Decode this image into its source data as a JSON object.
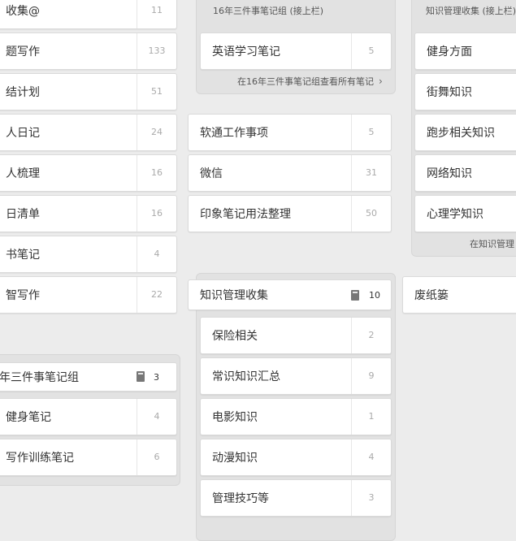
{
  "col1": {
    "notebooks": [
      {
        "label": "收集@",
        "count": "11"
      },
      {
        "label": "题写作",
        "count": "133"
      },
      {
        "label": "结计划",
        "count": "51"
      },
      {
        "label": "人日记",
        "count": "24"
      },
      {
        "label": "人梳理",
        "count": "16"
      },
      {
        "label": "日清单",
        "count": "16"
      },
      {
        "label": "书笔记",
        "count": "4"
      },
      {
        "label": "智写作",
        "count": "22"
      }
    ],
    "stack": {
      "title": "年三件事笔记组",
      "count": "3",
      "notebooks": [
        {
          "label": "健身笔记",
          "count": "4"
        },
        {
          "label": "写作训练笔记",
          "count": "6"
        }
      ]
    }
  },
  "col2": {
    "stack_top": {
      "title": "16年三件事笔记组 (接上栏)",
      "notebooks": [
        {
          "label": "英语学习笔记",
          "count": "5"
        }
      ],
      "footer": "在16年三件事笔记组查看所有笔记"
    },
    "notebooks": [
      {
        "label": "软通工作事项",
        "count": "5"
      },
      {
        "label": "微信",
        "count": "31"
      },
      {
        "label": "印象笔记用法整理",
        "count": "50"
      }
    ],
    "stack": {
      "title": "知识管理收集",
      "count": "10",
      "notebooks": [
        {
          "label": "保险相关",
          "count": "2"
        },
        {
          "label": "常识知识汇总",
          "count": "9"
        },
        {
          "label": "电影知识",
          "count": "1"
        },
        {
          "label": "动漫知识",
          "count": "4"
        },
        {
          "label": "管理技巧等",
          "count": "3"
        }
      ]
    }
  },
  "col3": {
    "stack_top": {
      "title": "知识管理收集 (接上栏)",
      "notebooks": [
        {
          "label": "健身方面"
        },
        {
          "label": "街舞知识"
        },
        {
          "label": "跑步相关知识"
        },
        {
          "label": "网络知识"
        },
        {
          "label": "心理学知识"
        }
      ],
      "footer": "在知识管理"
    },
    "trash": {
      "label": "废纸篓"
    }
  }
}
